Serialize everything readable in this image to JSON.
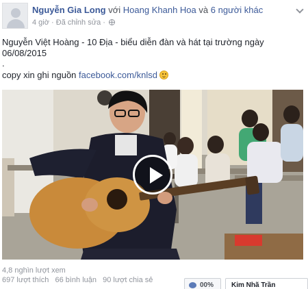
{
  "header": {
    "author": "Nguyễn Gia Long",
    "with_word": "với",
    "tagged": "Hoang Khanh Hoa",
    "and_word": "và",
    "others": "6 người khác",
    "time": "4 giờ",
    "separator": "·",
    "edited": "Đã chỉnh sửa",
    "separator2": "·"
  },
  "post": {
    "line1": "Nguyễn Việt Hoàng - 10 Địa - biểu diễn đàn và hát tại trường ngày",
    "line2": "06/08/2015",
    "line3": ".",
    "credit_prefix": "copy xin ghi nguồn",
    "credit_link": "facebook.com/knlsd"
  },
  "stats": {
    "views": "4,8 nghìn lượt xem",
    "likes": "697 lượt thích",
    "comments": "66 bình luận",
    "shares": "90 lượt chia sẻ"
  },
  "footer": {
    "badge_text": "00%",
    "chip_text": "Kim Nhã Trần"
  },
  "icons": {
    "globe": "globe-icon",
    "chevron": "chevron-down-icon",
    "smile": "smile-icon",
    "play": "play-icon",
    "eye": "eye-icon"
  },
  "colors": {
    "link": "#3b5998",
    "muted": "#90949c",
    "text": "#1d2129"
  }
}
